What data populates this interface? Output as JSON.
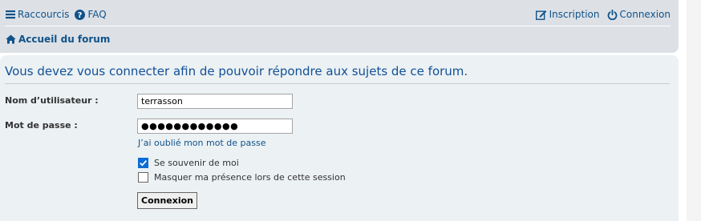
{
  "navbar": {
    "left_links": [
      {
        "label": "Raccourcis",
        "icon": "bars-icon"
      },
      {
        "label": "FAQ",
        "icon": "question-circle-icon"
      }
    ],
    "right_links": [
      {
        "label": "Inscription",
        "icon": "edit-icon"
      },
      {
        "label": "Connexion",
        "icon": "power-icon"
      }
    ],
    "breadcrumb": {
      "label": "Accueil du forum",
      "icon": "home-icon"
    }
  },
  "login": {
    "message": "Vous devez vous connecter afin de pouvoir répondre aux sujets de ce forum.",
    "username_label": "Nom d’utilisateur :",
    "username_value": "terrasson",
    "password_label": "Mot de passe :",
    "password_value": "●●●●●●●●●●●●",
    "forgot_label": "J’ai oublié mon mot de passe",
    "remember_label": "Se souvenir de moi",
    "remember_checked": true,
    "hide_label": "Masquer ma présence lors de cette session",
    "hide_checked": false,
    "submit_label": "Connexion"
  },
  "colors": {
    "navbar_bg": "#dde1e6",
    "panel_bg": "#ecf1f3",
    "link": "#105289",
    "title": "#115098",
    "checkbox_checked": "#0b6cd6"
  }
}
